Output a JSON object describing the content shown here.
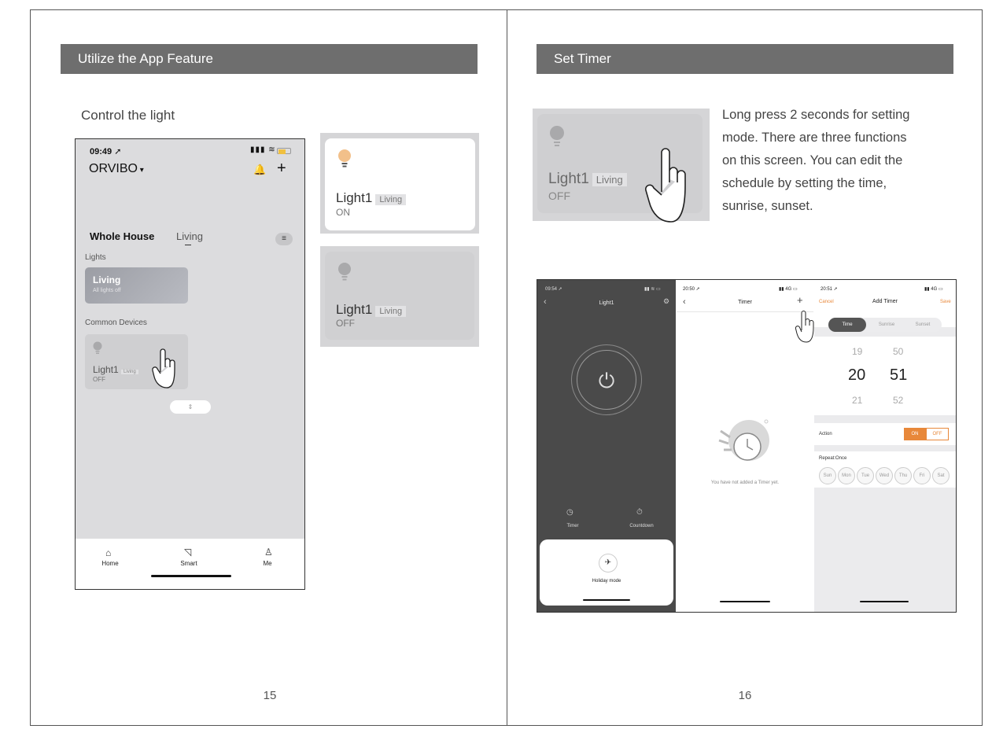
{
  "left_page": {
    "banner": "Utilize the App Feature",
    "subtitle": "Control the light",
    "page_number": "15",
    "phone": {
      "time": "09:49",
      "brand": "ORVIBO",
      "tab_active": "Whole House",
      "tab_other": "Living",
      "section_lights": "Lights",
      "room_card_title": "Living",
      "room_card_sub": "All lights off",
      "section_common": "Common Devices",
      "device_name": "Light1",
      "device_room": "Living",
      "device_state": "OFF",
      "tabs": [
        "Home",
        "Smart",
        "Me"
      ]
    },
    "card_on": {
      "name": "Light1",
      "room": "Living",
      "state": "ON"
    },
    "card_off": {
      "name": "Light1",
      "room": "Living",
      "state": "OFF"
    }
  },
  "right_page": {
    "banner": "Set Timer",
    "page_number": "16",
    "big_card": {
      "name": "Light1",
      "room": "Living",
      "state": "OFF"
    },
    "lines": [
      "Long press 2 seconds for setting",
      "mode. There are three functions",
      "on this screen. You can edit the",
      "schedule by setting the time,",
      "sunrise, sunset."
    ],
    "screen1": {
      "time": "09:54",
      "title": "Light1",
      "timer_label": "Timer",
      "countdown_label": "Countdown",
      "holiday_label": "Holiday mode"
    },
    "screen2": {
      "time": "20:50",
      "title": "Timer",
      "empty_text": "You have not added a Timer yet.",
      "network": "4G"
    },
    "screen3": {
      "time": "20:51",
      "network": "4G",
      "cancel": "Cancel",
      "title": "Add Timer",
      "save": "Save",
      "segments": [
        "Time",
        "Sunrise",
        "Sunset"
      ],
      "hour_prev": "19",
      "hour": "20",
      "hour_next": "21",
      "min_prev": "50",
      "min": "51",
      "min_next": "52",
      "action_label": "Action",
      "on": "ON",
      "off": "OFF",
      "repeat_label": "Repeat:Once",
      "days": [
        "Sun",
        "Mon",
        "Tue",
        "Wed",
        "Thu",
        "Fri",
        "Sat"
      ]
    }
  },
  "colors": {
    "banner": "#6e6e6e",
    "accent_orange": "#e8883a",
    "bulb_on": "#f2c08a"
  }
}
